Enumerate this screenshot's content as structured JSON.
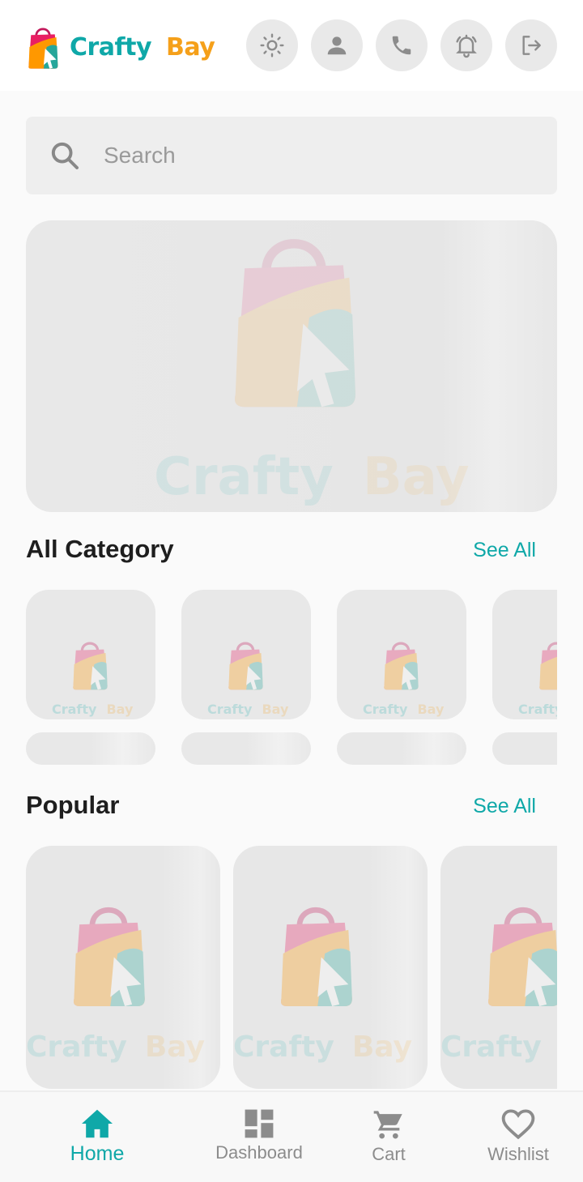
{
  "header": {
    "brand_part1": "Crafty",
    "brand_part2": "Bay",
    "icons": [
      "sun-icon",
      "person-icon",
      "phone-icon",
      "bell-icon",
      "logout-icon"
    ]
  },
  "search": {
    "placeholder": "Search",
    "value": ""
  },
  "banner": {
    "watermark_part1": "Crafty",
    "watermark_part2": "Bay"
  },
  "sections": {
    "category": {
      "title": "All Category",
      "see_all": "See All"
    },
    "popular": {
      "title": "Popular",
      "see_all": "See All"
    }
  },
  "placeholder_brand": {
    "a": "Crafty",
    "b": "Bay"
  },
  "bottom_nav": {
    "items": [
      {
        "label": "Home",
        "icon": "home-icon",
        "active": true
      },
      {
        "label": "Dashboard",
        "icon": "dashboard-icon",
        "active": false
      },
      {
        "label": "Cart",
        "icon": "cart-icon",
        "active": false
      },
      {
        "label": "Wishlist",
        "icon": "heart-icon",
        "active": false
      }
    ]
  },
  "colors": {
    "brand_teal": "#0fa8a8",
    "brand_orange": "#f5a01a",
    "icon_gray": "#8c8c8c",
    "skeleton": "#e8e8e8"
  }
}
